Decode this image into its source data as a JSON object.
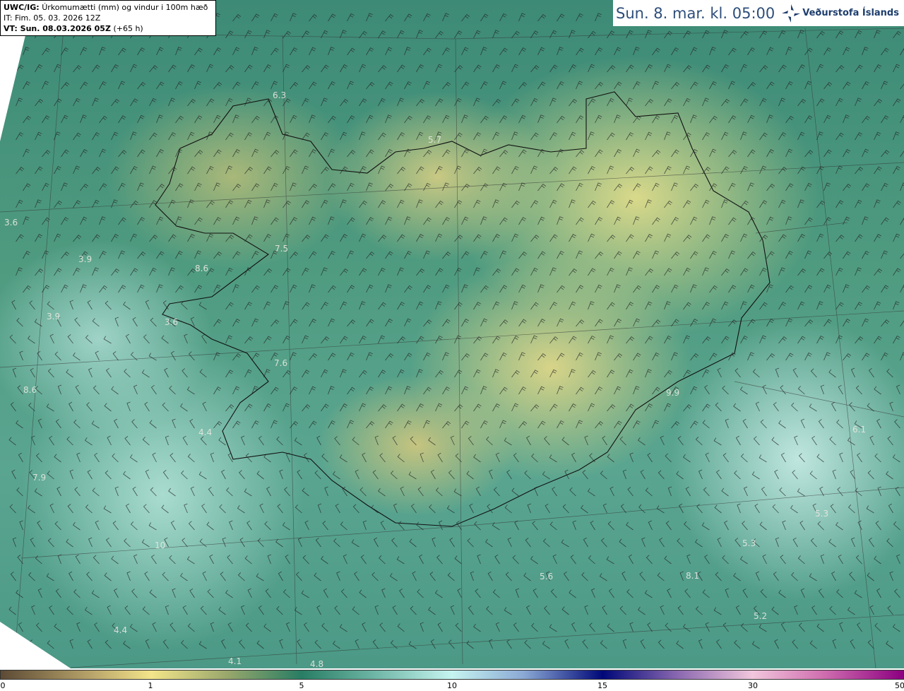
{
  "header": {
    "product": "UWC/IG:",
    "description": "Úrkomumætti (mm) og vindur i 100m hæð",
    "initial_time": "IT: Fim. 05. 03. 2026 12Z",
    "valid_label": "VT: Sun. 08.03.2026 05Z",
    "lead": "(+65 h)"
  },
  "title": {
    "datetime": "Sun. 8. mar. kl. 05:00",
    "brand": "Veðurstofa Íslands"
  },
  "colorbar": {
    "ticks": [
      "0",
      "1",
      "5",
      "10",
      "15",
      "30",
      "50"
    ],
    "colors": [
      "#5c4a35",
      "#f3e58a",
      "#287d64",
      "#c6f4f0",
      "#000878",
      "#f2c6dc",
      "#8c0080"
    ]
  },
  "map_labels": [
    "6.3",
    "5.7",
    "3.6",
    "3.9",
    "7.5",
    "8.6",
    "3.9",
    "3.6",
    "7.6",
    "8.6",
    "4.4",
    "7.9",
    "9.9",
    "6.1",
    "5.3",
    "5.3",
    "5.6",
    "8.1",
    "5.2",
    "4.4",
    "4.1",
    "4.8",
    "10"
  ]
}
